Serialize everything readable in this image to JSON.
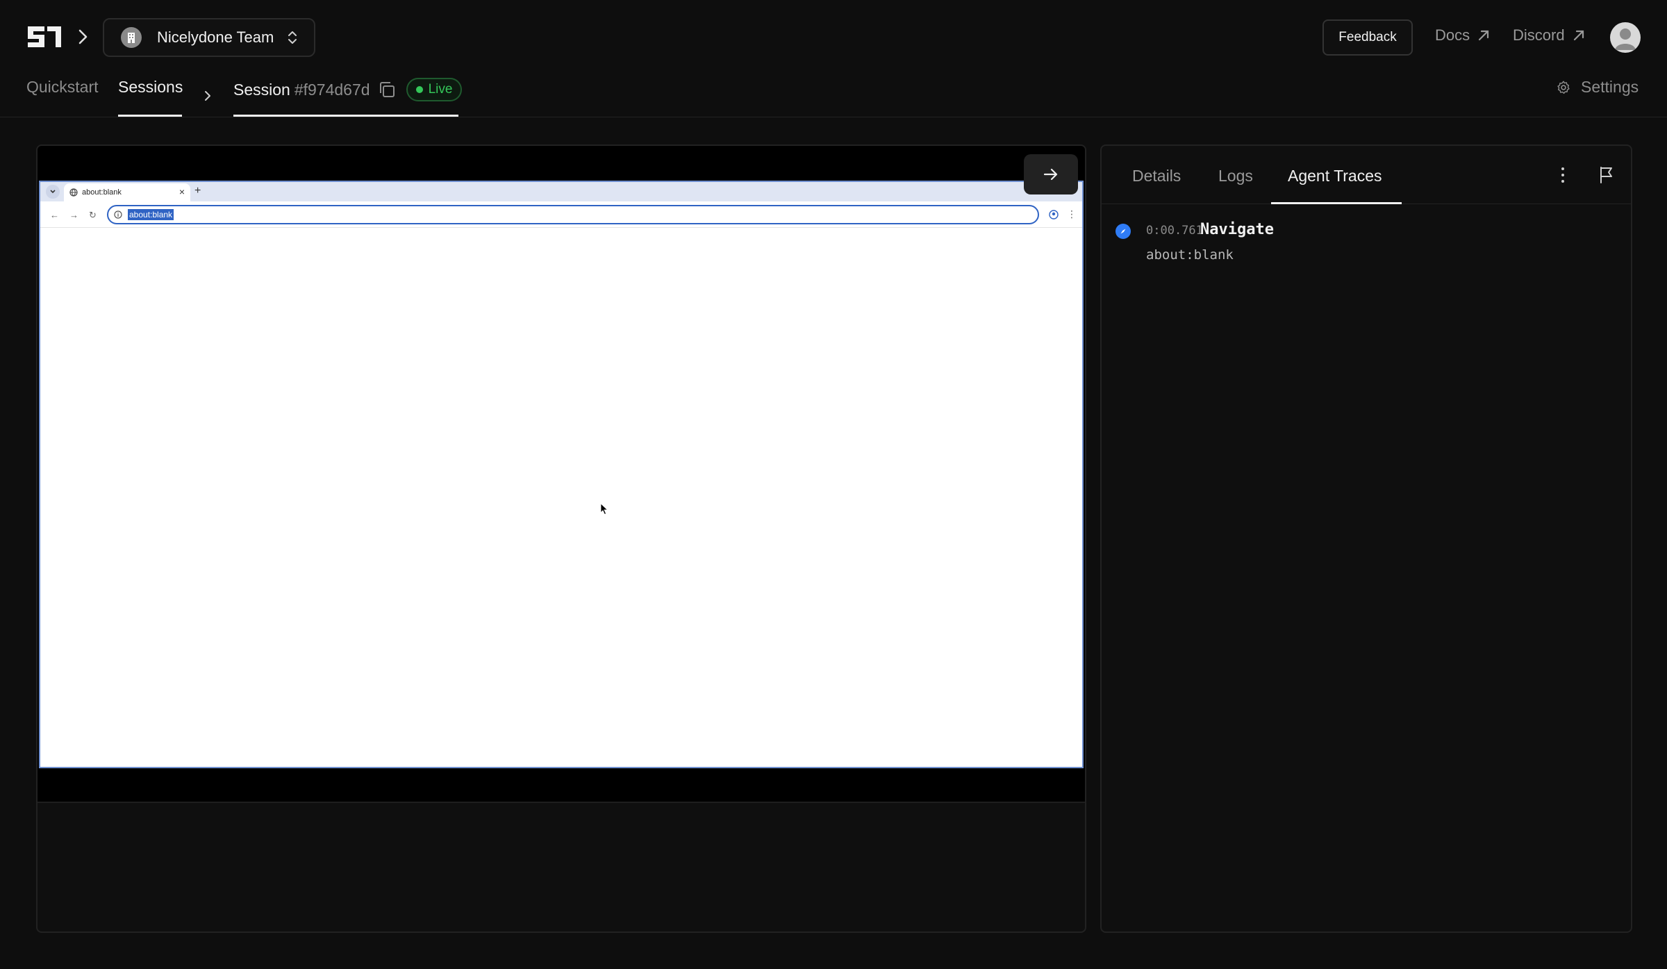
{
  "header": {
    "team_name": "Nicelydone Team",
    "feedback_label": "Feedback",
    "docs_label": "Docs",
    "discord_label": "Discord"
  },
  "nav": {
    "quickstart_label": "Quickstart",
    "sessions_label": "Sessions",
    "session_label": "Session",
    "session_id": "#f974d67d",
    "live_label": "Live",
    "settings_label": "Settings"
  },
  "browser": {
    "tab_title": "about:blank",
    "address": "about:blank"
  },
  "trace_panel": {
    "tabs": [
      {
        "label": "Details"
      },
      {
        "label": "Logs"
      },
      {
        "label": "Agent Traces"
      }
    ],
    "active_tab": "Agent Traces",
    "traces": [
      {
        "time": "0:00.761",
        "action": "Navigate",
        "detail": "about:blank"
      }
    ]
  },
  "colors": {
    "background": "#0e0e0e",
    "live_green": "#34c759",
    "trace_blue": "#2f7cf6",
    "omnibox_blue": "#2f63c4"
  }
}
